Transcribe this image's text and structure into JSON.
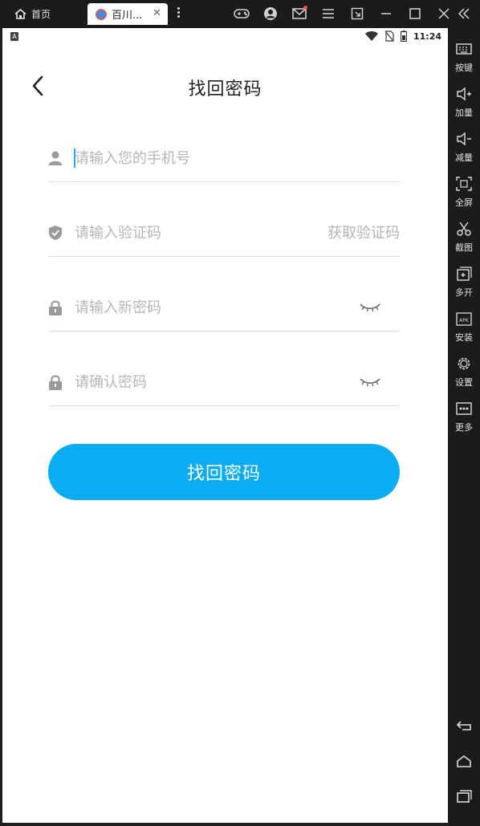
{
  "emulator": {
    "home_tab_label": "首页",
    "app_tab_label": "百川...",
    "tab_close": "✕"
  },
  "statusbar": {
    "time": "11:24"
  },
  "page": {
    "title": "找回密码",
    "fields": {
      "phone_placeholder": "请输入您的手机号",
      "code_placeholder": "请输入验证码",
      "get_code_label": "获取验证码",
      "new_password_placeholder": "请输入新密码",
      "confirm_password_placeholder": "请确认密码"
    },
    "submit_label": "找回密码"
  },
  "sidebar": {
    "items": [
      {
        "label": "按键",
        "icon": "keyboard-icon"
      },
      {
        "label": "加量",
        "icon": "volume-up-icon"
      },
      {
        "label": "减量",
        "icon": "volume-down-icon"
      },
      {
        "label": "全屏",
        "icon": "fullscreen-icon"
      },
      {
        "label": "截图",
        "icon": "scissors-icon"
      },
      {
        "label": "多开",
        "icon": "multi-instance-icon"
      },
      {
        "label": "安装",
        "icon": "apk-install-icon"
      },
      {
        "label": "设置",
        "icon": "gear-icon"
      },
      {
        "label": "更多",
        "icon": "more-icon"
      }
    ],
    "nav": [
      "back-icon",
      "home-icon",
      "recents-icon"
    ]
  },
  "colors": {
    "accent": "#0aacf2",
    "placeholder": "#b6b6b6",
    "divider": "#dcdcdc"
  }
}
